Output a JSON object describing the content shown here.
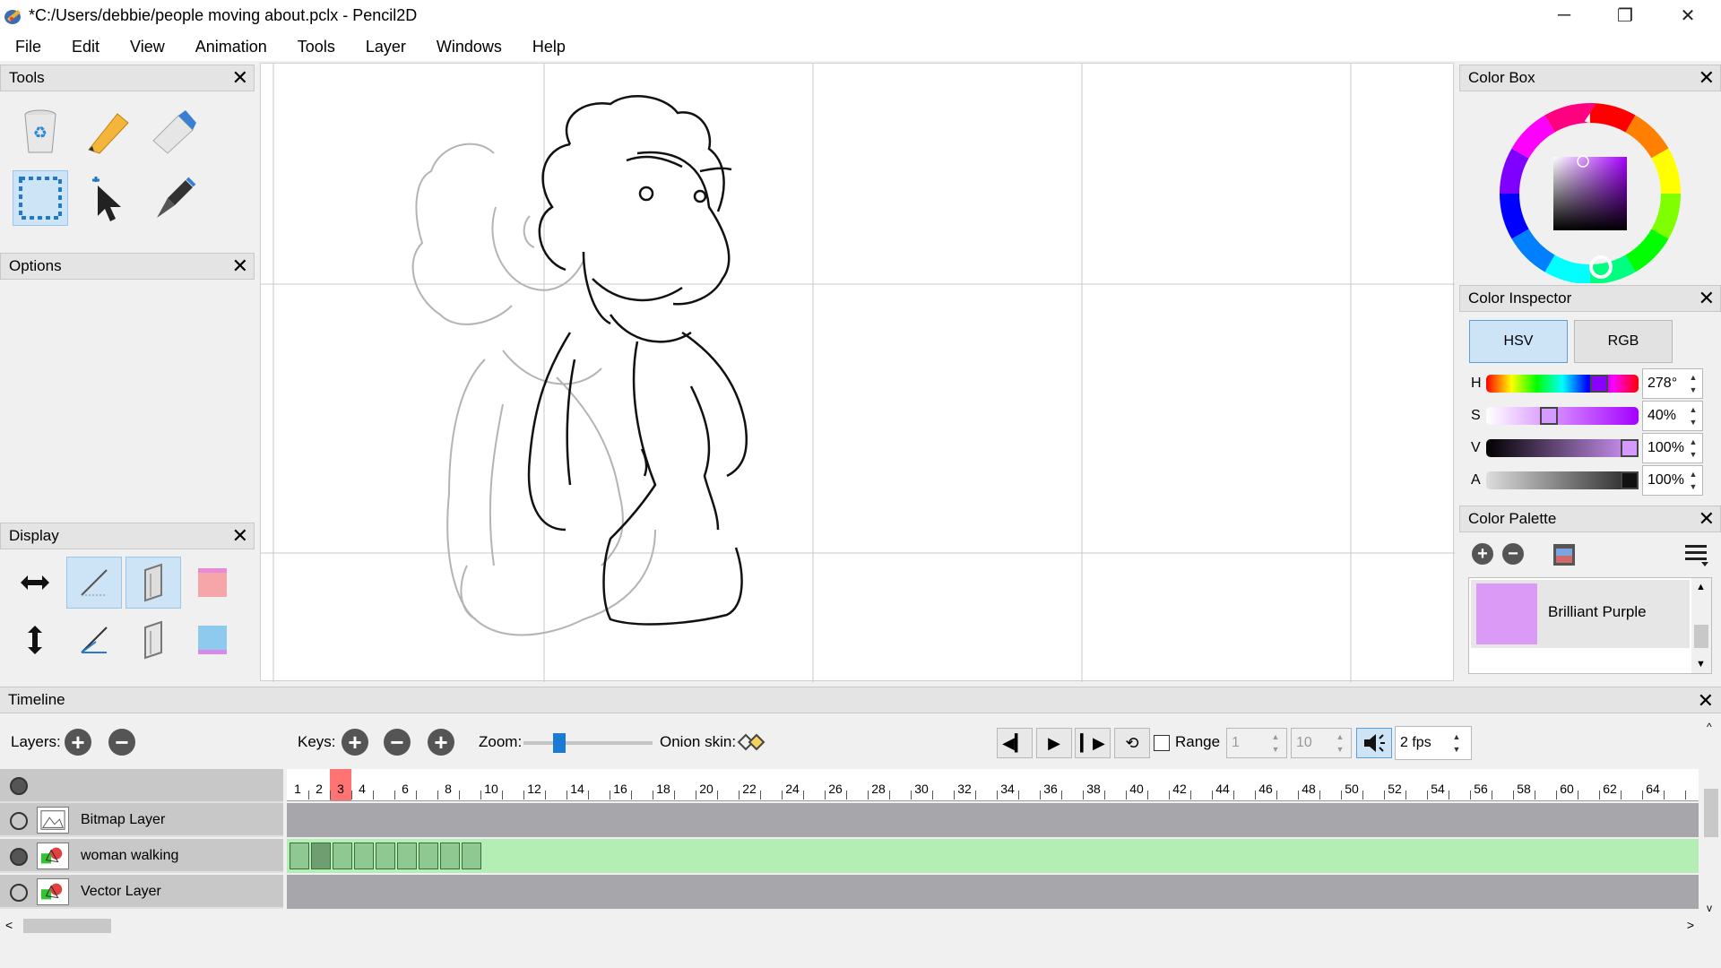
{
  "window": {
    "title": "*C:/Users/debbie/people moving about.pclx - Pencil2D",
    "minimize": "─",
    "restore": "❐",
    "close": "✕"
  },
  "menu": [
    "File",
    "Edit",
    "View",
    "Animation",
    "Tools",
    "Layer",
    "Windows",
    "Help"
  ],
  "panels": {
    "tools": "Tools",
    "options": "Options",
    "display": "Display",
    "color_box": "Color Box",
    "color_inspector": "Color Inspector",
    "color_palette": "Color Palette",
    "close_glyph": "✕"
  },
  "tool_icons": [
    "clear-icon",
    "pencil-icon",
    "eraser-icon",
    "select-icon",
    "move-icon",
    "pen-icon"
  ],
  "display_icons": [
    "horizontal-flip-icon",
    "overlay-thirds-icon",
    "overlay-safe-area-icon",
    "onion-prev-color-icon",
    "vertical-flip-icon",
    "overlay-perspective-icon",
    "overlay-golden-icon",
    "onion-next-color-icon"
  ],
  "color_inspector": {
    "modes": [
      "HSV",
      "RGB"
    ],
    "active_mode": "HSV",
    "channels": [
      {
        "label": "H",
        "value": "278°",
        "level": 0.772
      },
      {
        "label": "S",
        "value": "40%",
        "level": 0.4
      },
      {
        "label": "V",
        "value": "100%",
        "level": 1.0
      },
      {
        "label": "A",
        "value": "100%",
        "level": 1.0
      }
    ]
  },
  "current_color": "#d59aff",
  "palette": {
    "swatch_name": "Brilliant Purple",
    "swatch_color": "#dc9af7"
  },
  "timeline": {
    "title": "Timeline",
    "layers_label": "Layers:",
    "keys_label": "Keys:",
    "zoom_label": "Zoom:",
    "zoom_level": 0.25,
    "onion_label": "Onion skin:",
    "range_label": "Range",
    "range_start": "1",
    "range_end": "10",
    "fps": "2 fps",
    "current_frame": 3,
    "frame_numbers": [
      "1",
      "2",
      "3",
      "4",
      "6",
      "8",
      "10",
      "12",
      "14",
      "16",
      "18",
      "20",
      "22",
      "24",
      "26",
      "28",
      "30",
      "32",
      "34",
      "36",
      "38",
      "40",
      "42",
      "44",
      "46",
      "48",
      "50",
      "52",
      "54",
      "56",
      "58",
      "60",
      "62",
      "64"
    ],
    "layers": [
      {
        "name": "Bitmap Layer",
        "visible": false,
        "type": "bitmap"
      },
      {
        "name": "woman walking",
        "visible": true,
        "type": "vector"
      },
      {
        "name": "Vector Layer",
        "visible": false,
        "type": "vector"
      }
    ],
    "keyframe_count": 9
  }
}
